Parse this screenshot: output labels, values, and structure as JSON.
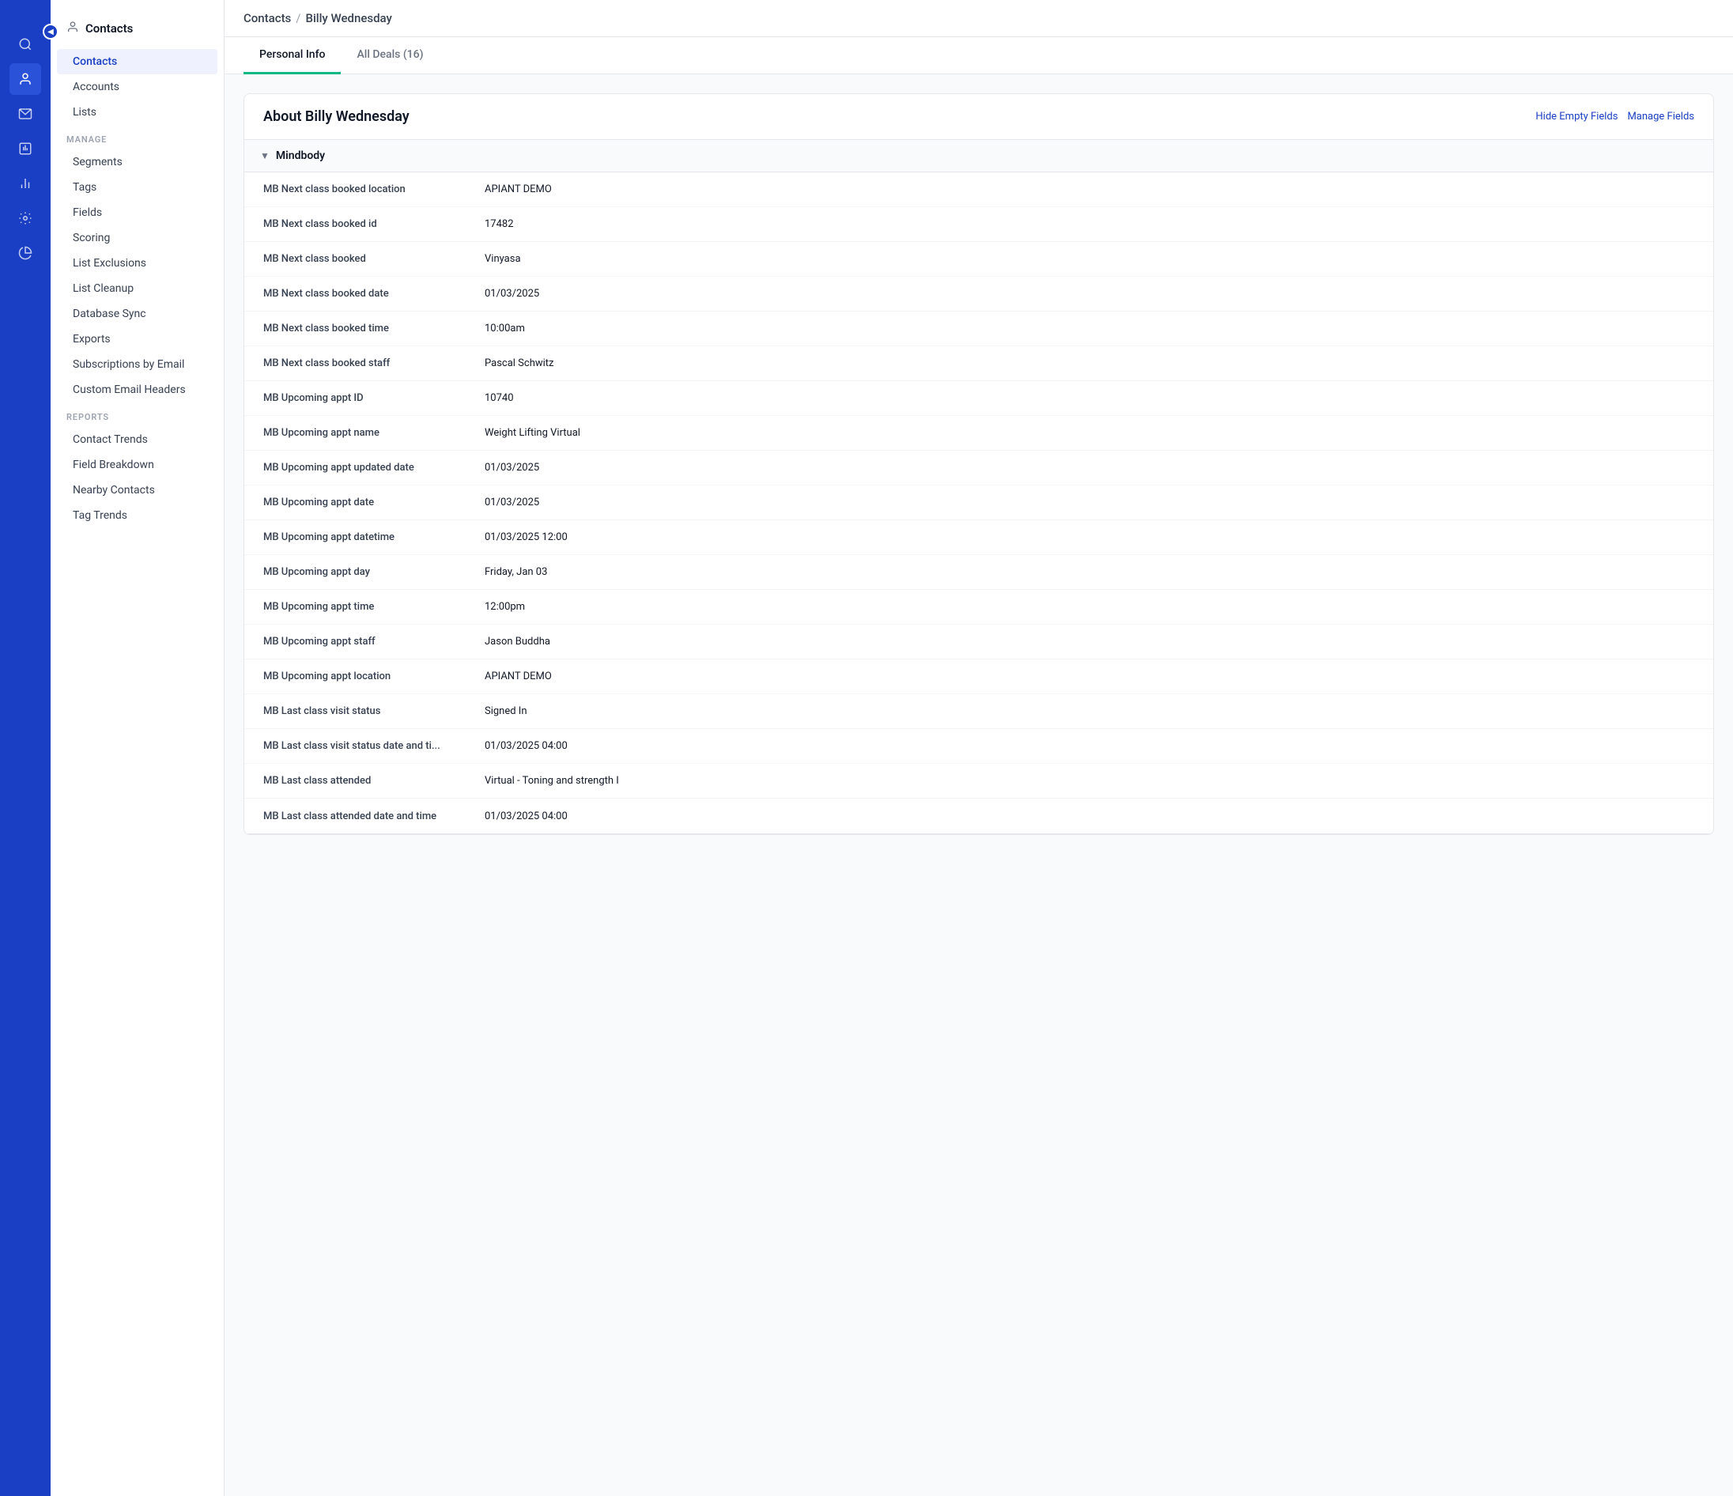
{
  "app": {
    "collapse_icon": "◀"
  },
  "icon_nav": [
    {
      "id": "collapse",
      "icon": "◀",
      "active": false
    },
    {
      "id": "search",
      "icon": "🔍",
      "active": false
    },
    {
      "id": "contacts",
      "icon": "👤",
      "active": true
    },
    {
      "id": "email",
      "icon": "✉",
      "active": false
    },
    {
      "id": "reports",
      "icon": "📊",
      "active": false
    },
    {
      "id": "analytics",
      "icon": "📈",
      "active": false
    },
    {
      "id": "settings",
      "icon": "⚙",
      "active": false
    },
    {
      "id": "pie",
      "icon": "◕",
      "active": false
    }
  ],
  "left_nav": {
    "header": {
      "icon": "👤",
      "label": "Contacts"
    },
    "main_items": [
      {
        "id": "contacts",
        "label": "Contacts",
        "active": true
      },
      {
        "id": "accounts",
        "label": "Accounts",
        "active": false
      },
      {
        "id": "lists",
        "label": "Lists",
        "active": false
      }
    ],
    "manage_section": {
      "title": "MANAGE",
      "items": [
        {
          "id": "segments",
          "label": "Segments"
        },
        {
          "id": "tags",
          "label": "Tags"
        },
        {
          "id": "fields",
          "label": "Fields"
        },
        {
          "id": "scoring",
          "label": "Scoring"
        },
        {
          "id": "list-exclusions",
          "label": "List Exclusions"
        },
        {
          "id": "list-cleanup",
          "label": "List Cleanup"
        },
        {
          "id": "database-sync",
          "label": "Database Sync"
        },
        {
          "id": "exports",
          "label": "Exports"
        },
        {
          "id": "subscriptions-by-email",
          "label": "Subscriptions by Email"
        },
        {
          "id": "custom-email-headers",
          "label": "Custom Email Headers"
        }
      ]
    },
    "reports_section": {
      "title": "REPORTS",
      "items": [
        {
          "id": "contact-trends",
          "label": "Contact Trends"
        },
        {
          "id": "field-breakdown",
          "label": "Field Breakdown"
        },
        {
          "id": "nearby-contacts",
          "label": "Nearby Contacts"
        },
        {
          "id": "tag-trends",
          "label": "Tag Trends"
        }
      ]
    }
  },
  "breadcrumb": {
    "link": "Contacts",
    "separator": "/",
    "current": "Billy Wednesday"
  },
  "tabs": [
    {
      "id": "personal-info",
      "label": "Personal Info",
      "active": true
    },
    {
      "id": "all-deals",
      "label": "All Deals (16)",
      "active": false
    }
  ],
  "card": {
    "title": "About Billy Wednesday",
    "actions": [
      {
        "id": "hide-empty-fields",
        "label": "Hide Empty Fields"
      },
      {
        "id": "manage-fields",
        "label": "Manage Fields"
      }
    ],
    "sections": [
      {
        "id": "mindbody",
        "label": "Mindbody",
        "collapsed": false,
        "fields": [
          {
            "label": "MB Next class booked location",
            "value": "APIANT DEMO"
          },
          {
            "label": "MB Next class booked id",
            "value": "17482"
          },
          {
            "label": "MB Next class booked",
            "value": "Vinyasa"
          },
          {
            "label": "MB Next class booked date",
            "value": "01/03/2025"
          },
          {
            "label": "MB Next class booked time",
            "value": "10:00am"
          },
          {
            "label": "MB Next class booked staff",
            "value": "Pascal Schwitz"
          },
          {
            "label": "MB Upcoming appt ID",
            "value": "10740"
          },
          {
            "label": "MB Upcoming appt name",
            "value": "Weight Lifting Virtual"
          },
          {
            "label": "MB Upcoming appt updated date",
            "value": "01/03/2025"
          },
          {
            "label": "MB Upcoming appt date",
            "value": "01/03/2025"
          },
          {
            "label": "MB Upcoming appt datetime",
            "value": "01/03/2025 12:00"
          },
          {
            "label": "MB Upcoming appt day",
            "value": "Friday, Jan 03"
          },
          {
            "label": "MB Upcoming appt time",
            "value": "12:00pm"
          },
          {
            "label": "MB Upcoming appt staff",
            "value": "Jason Buddha"
          },
          {
            "label": "MB Upcoming appt location",
            "value": "APIANT DEMO"
          },
          {
            "label": "MB Last class visit status",
            "value": "Signed In"
          },
          {
            "label": "MB Last class visit status date and ti...",
            "value": "01/03/2025 04:00"
          },
          {
            "label": "MB Last class attended",
            "value": "Virtual - Toning and strength I"
          },
          {
            "label": "MB Last class attended date and time",
            "value": "01/03/2025 04:00"
          }
        ]
      }
    ]
  }
}
